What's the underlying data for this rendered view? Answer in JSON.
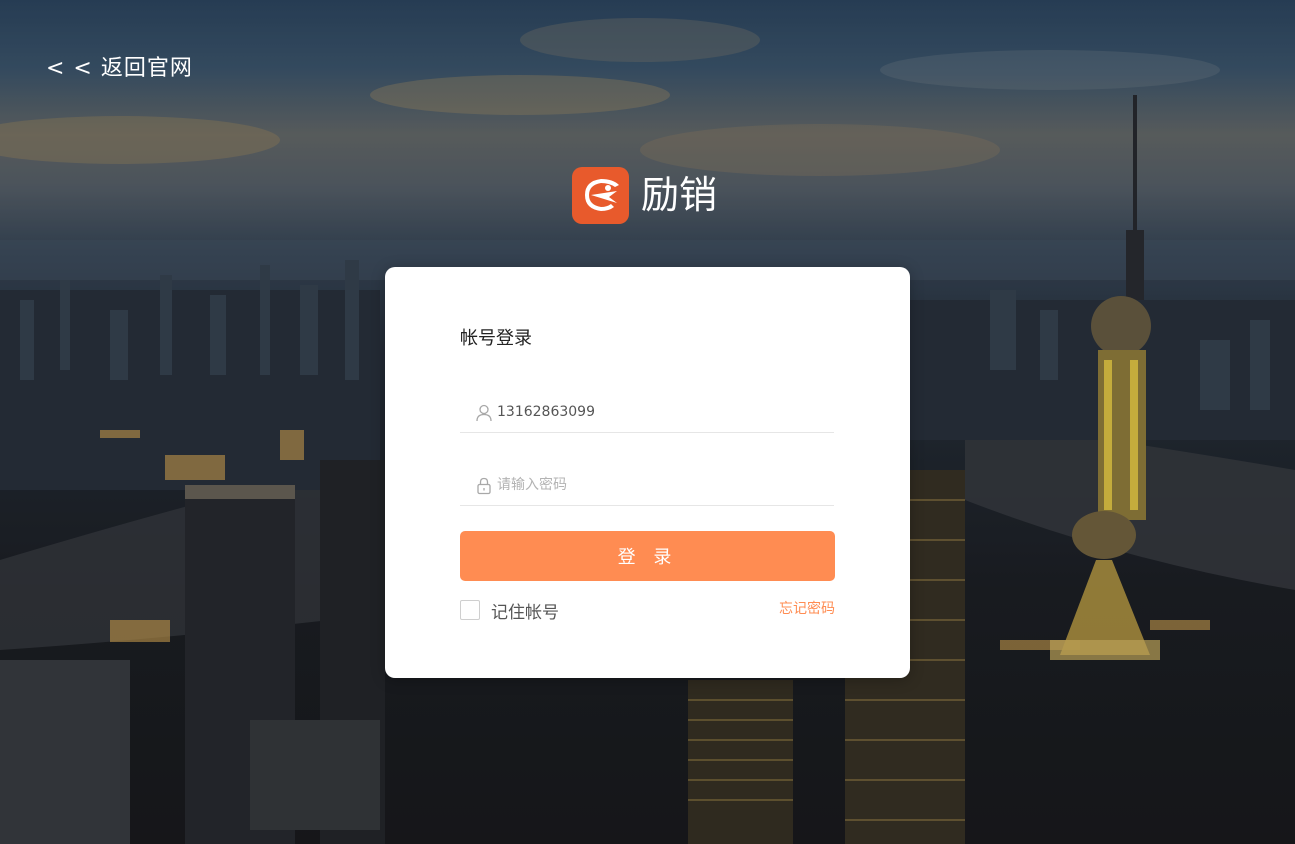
{
  "nav": {
    "back_label": "< < 返回官网"
  },
  "brand": {
    "name": "励销",
    "logo_color": "#e85a2c"
  },
  "login": {
    "title": "帐号登录",
    "username": {
      "value": "13162863099",
      "icon": "user-icon"
    },
    "password": {
      "value": "",
      "placeholder": "请输入密码",
      "icon": "lock-icon"
    },
    "submit_label": "登 录",
    "remember_label": "记住帐号",
    "remember_checked": false,
    "forgot_label": "忘记密码"
  },
  "colors": {
    "accent": "#ff8c52",
    "card_bg": "#ffffff"
  }
}
